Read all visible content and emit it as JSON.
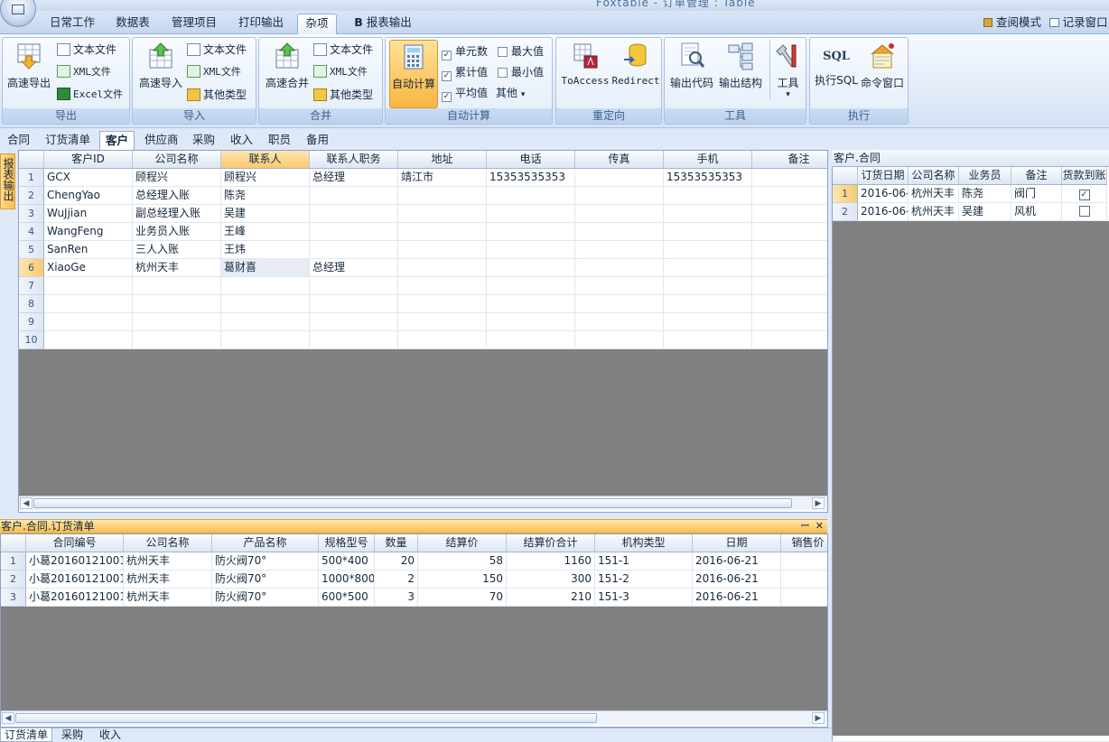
{
  "app": {
    "title": "Foxtable - 订单管理 : Table"
  },
  "ribbon_tabs": [
    "日常工作",
    "数据表",
    "管理项目",
    "打印输出",
    "杂项",
    "报表输出"
  ],
  "top_right": {
    "view_mode": "查阅模式",
    "record_window": "记录窗口"
  },
  "groups": {
    "export": {
      "caption": "导出",
      "big": "高速导出",
      "text": "文本文件",
      "xml": "XML文件",
      "excel": "Excel文件"
    },
    "import": {
      "caption": "导入",
      "big": "高速导入",
      "text": "文本文件",
      "xml": "XML文件",
      "other": "其他类型"
    },
    "merge": {
      "caption": "合并",
      "big": "高速合并",
      "text": "文本文件",
      "xml": "XML文件",
      "other": "其他类型"
    },
    "autocalc": {
      "caption": "自动计算",
      "big": "自动计算",
      "cell_count": "单元数",
      "cumulative": "累计值",
      "average": "平均值",
      "max": "最大值",
      "min": "最小值",
      "other": "其他"
    },
    "redirect": {
      "caption": "重定向",
      "toaccess": "ToAccess",
      "redirect": "Redirect"
    },
    "tools": {
      "caption": "工具",
      "output_code": "输出代码",
      "output_struct": "输出结构",
      "tools": "工具"
    },
    "exec": {
      "caption": "执行",
      "exec_sql": "执行SQL",
      "command": "命令窗口",
      "sql_badge": "SQL"
    }
  },
  "doc_tabs": [
    "合同",
    "订货清单",
    "客户",
    "供应商",
    "采购",
    "收入",
    "职员",
    "备用"
  ],
  "side_strip": "报表输出",
  "customers": {
    "columns": [
      "客户ID",
      "公司名称",
      "联系人",
      "联系人职务",
      "地址",
      "电话",
      "传真",
      "手机",
      "备注"
    ],
    "rows": [
      [
        "GCX",
        "顾程兴",
        "顾程兴",
        "总经理",
        "靖江市",
        "15353535353",
        "",
        "15353535353",
        ""
      ],
      [
        "ChengYao",
        "总经理入账",
        "陈尧",
        "",
        "",
        "",
        "",
        "",
        ""
      ],
      [
        "WuJjian",
        "副总经理入账",
        "吴建",
        "",
        "",
        "",
        "",
        "",
        ""
      ],
      [
        "WangFeng",
        "业务员入账",
        "王峰",
        "",
        "",
        "",
        "",
        "",
        ""
      ],
      [
        "SanRen",
        "三人入账",
        "王炜",
        "",
        "",
        "",
        "",
        "",
        ""
      ],
      [
        "XiaoGe",
        "杭州天丰",
        "葛财喜",
        "总经理",
        "",
        "",
        "",
        "",
        ""
      ],
      [
        "",
        "",
        "",
        "",
        "",
        "",
        "",
        "",
        ""
      ],
      [
        "",
        "",
        "",
        "",
        "",
        "",
        "",
        "",
        ""
      ],
      [
        "",
        "",
        "",
        "",
        "",
        "",
        "",
        "",
        ""
      ],
      [
        "",
        "",
        "",
        "",
        "",
        "",
        "",
        "",
        ""
      ]
    ],
    "row_numbers": [
      "1",
      "2",
      "3",
      "4",
      "5",
      "6",
      "7",
      "8",
      "9",
      "10"
    ]
  },
  "contract_panel": {
    "title": "客户.合同",
    "columns": [
      "订货日期",
      "公司名称",
      "业务员",
      "备注",
      "货款到账"
    ],
    "rows": [
      {
        "n": "1",
        "date": "2016-06-",
        "company": "杭州天丰",
        "sales": "陈尧",
        "note": "阀门",
        "paid": true
      },
      {
        "n": "2",
        "date": "2016-06-",
        "company": "杭州天丰",
        "sales": "吴建",
        "note": "风机",
        "paid": false
      }
    ]
  },
  "orders": {
    "title": "客户.合同.订货清单",
    "columns": [
      "合同编号",
      "公司名称",
      "产品名称",
      "规格型号",
      "数量",
      "结算价",
      "结算价合计",
      "机构类型",
      "日期",
      "销售价"
    ],
    "rows": [
      [
        "小葛20160121001",
        "杭州天丰",
        "防火阀70°",
        "500*400",
        "20",
        "58",
        "1160",
        "151-1",
        "2016-06-21",
        ""
      ],
      [
        "小葛20160121001",
        "杭州天丰",
        "防火阀70°",
        "1000*800",
        "2",
        "150",
        "300",
        "151-2",
        "2016-06-21",
        ""
      ],
      [
        "小葛20160121001",
        "杭州天丰",
        "防火阀70°",
        "600*500",
        "3",
        "70",
        "210",
        "151-3",
        "2016-06-21",
        ""
      ]
    ],
    "row_numbers": [
      "1",
      "2",
      "3"
    ]
  },
  "bottom_tabs": [
    "订货清单",
    "采购",
    "收入"
  ],
  "glyphs": {
    "pin": "ꟷ",
    "close": "✕",
    "left": "◀",
    "right": "▶",
    "check": "✓",
    "dropdown": "▾",
    "bold_b": "B"
  }
}
